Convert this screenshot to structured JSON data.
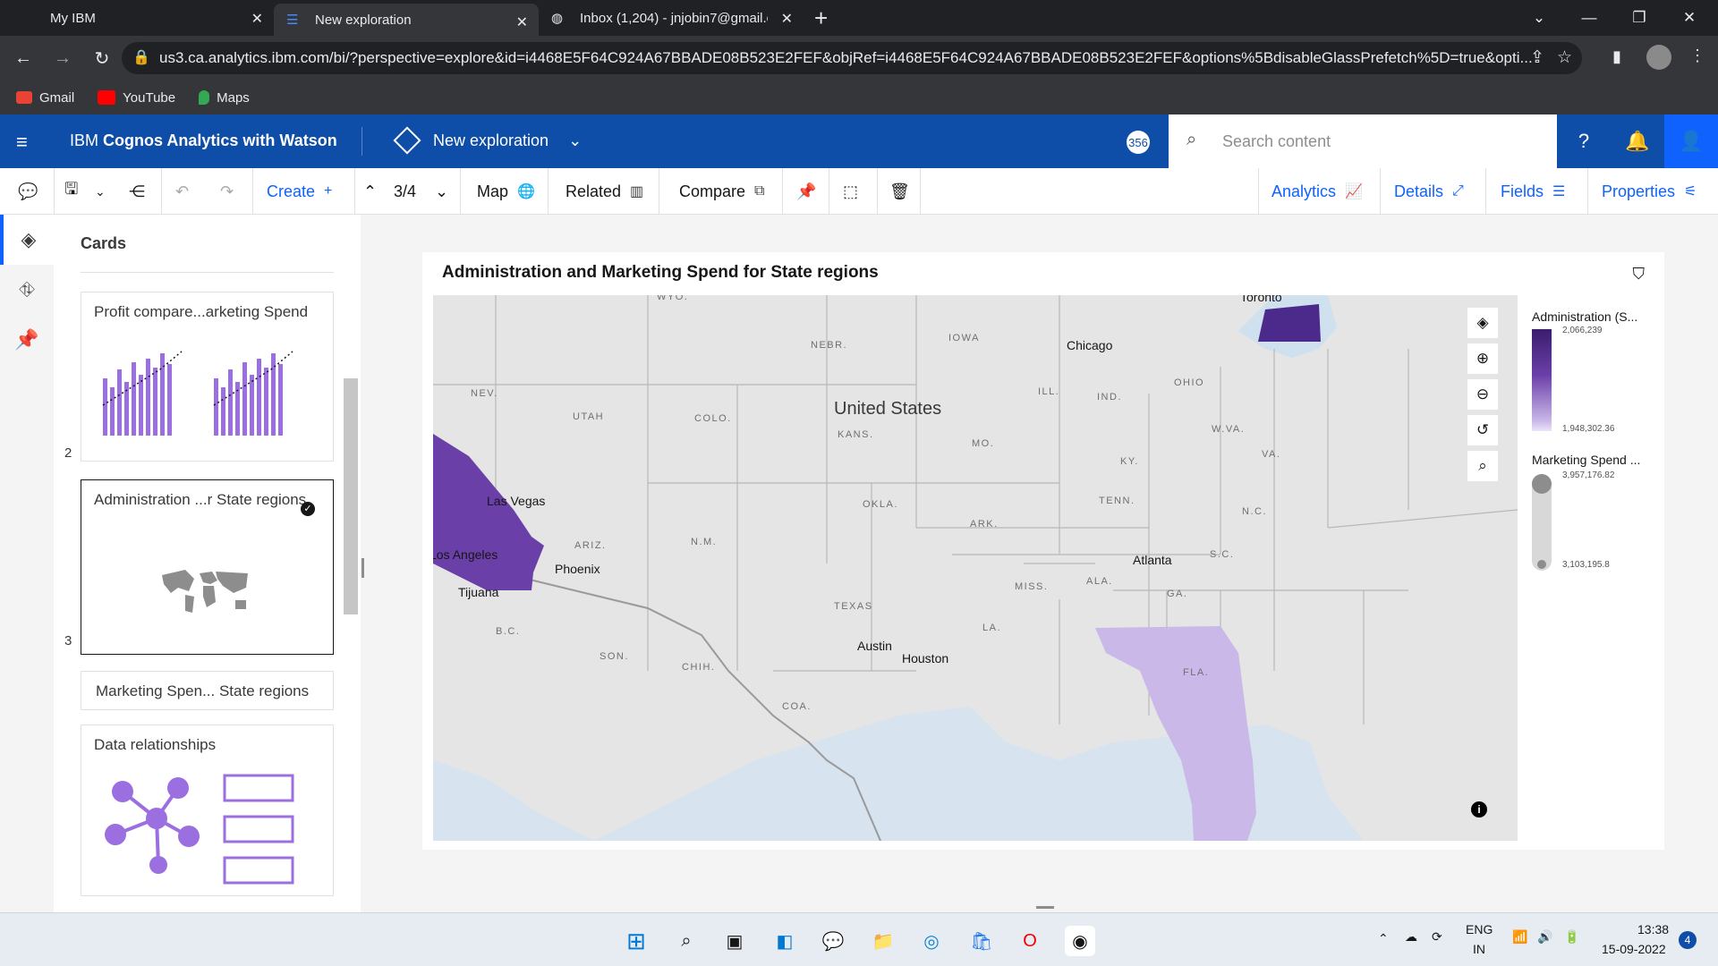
{
  "browser": {
    "tabs": [
      {
        "label": "My IBM"
      },
      {
        "label": "New exploration"
      },
      {
        "label": "Inbox (1,204) - jnjobin7@gmail.c"
      }
    ],
    "url": "us3.ca.analytics.ibm.com/bi/?perspective=explore&id=i4468E5F64C924A67BBADE08B523E2FEF&objRef=i4468E5F64C924A67BBADE08B523E2FEF&options%5BdisableGlassPrefetch%5D=true&opti...",
    "bookmarks": [
      {
        "label": "Gmail"
      },
      {
        "label": "YouTube"
      },
      {
        "label": "Maps"
      }
    ]
  },
  "app": {
    "product_prefix": "IBM",
    "product_name": "Cognos Analytics with Watson",
    "exploration": "New exploration",
    "badge": "356",
    "search_placeholder": "Search content"
  },
  "toolbar": {
    "create": "Create",
    "pager": "3/4",
    "map": "Map",
    "related": "Related",
    "compare": "Compare",
    "analytics": "Analytics",
    "details": "Details",
    "fields": "Fields",
    "properties": "Properties"
  },
  "cards": {
    "title": "Cards",
    "items": [
      {
        "label": "Profit compare...arketing Spend",
        "num": "2"
      },
      {
        "label": "Administration ...r State regions",
        "num": "3"
      },
      {
        "label": "Marketing Spen... State regions"
      },
      {
        "label": "Data relationships"
      }
    ]
  },
  "map": {
    "title": "Administration and Marketing Spend for State regions",
    "country": "United States",
    "cities": [
      "Toronto",
      "Chicago",
      "Las Vegas",
      "Los Angeles",
      "Phoenix",
      "Tijuana",
      "Austin",
      "Houston",
      "Atlanta"
    ],
    "states": [
      "WYO.",
      "NEBR.",
      "IOWA",
      "NEV.",
      "UTAH",
      "COLO.",
      "KANS.",
      "MO.",
      "ILL.",
      "IND.",
      "OHIO",
      "W.VA.",
      "VA.",
      "KY.",
      "TENN.",
      "N.C.",
      "S.C.",
      "GA.",
      "ALA.",
      "MISS.",
      "ARK.",
      "OKLA.",
      "TEXAS",
      "LA.",
      "N.M.",
      "ARIZ.",
      "FLA.",
      "B.C.",
      "SON.",
      "CHIH.",
      "COA."
    ],
    "legend": {
      "admin_title": "Administration (S...",
      "admin_max": "2,066,239",
      "admin_min": "1,948,302.36",
      "marketing_title": "Marketing Spend ...",
      "marketing_max": "3,957,176.82",
      "marketing_min": "3,103,195.8"
    },
    "colors": {
      "admin_high": "#4b2a8c",
      "admin_mid": "#6b3fa8",
      "admin_low": "#c9b8e8"
    }
  },
  "taskbar": {
    "lang": "ENG",
    "region": "IN",
    "time": "13:38",
    "date": "15-09-2022",
    "notif": "4"
  }
}
